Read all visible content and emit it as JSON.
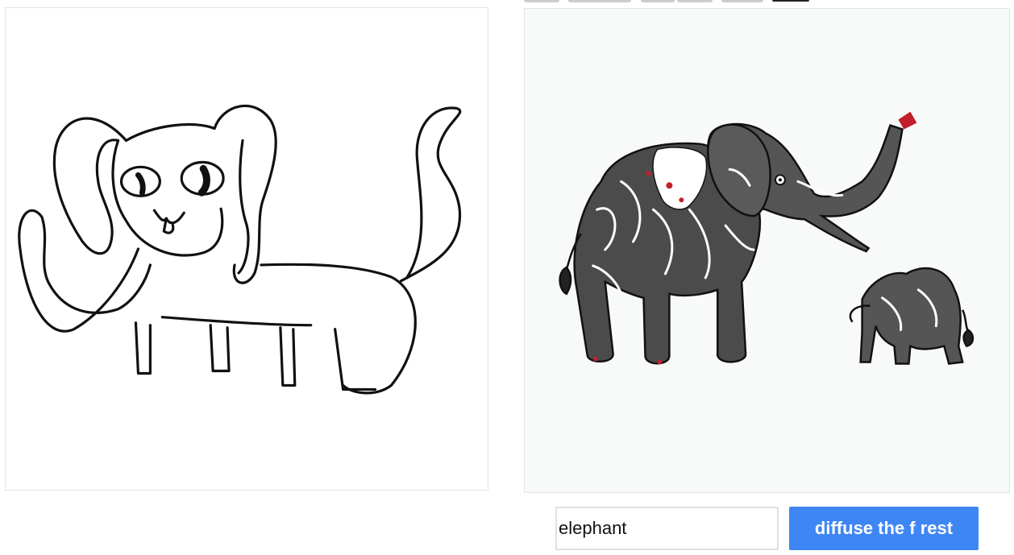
{
  "prompt": {
    "value": "elephant",
    "placeholder": ""
  },
  "generate_button": {
    "label": "diffuse the f rest"
  },
  "colors": {
    "accent": "#3f86f5",
    "ink": "#111111",
    "elephant_body": "#4b4b4b",
    "ornament_red": "#c0202a"
  },
  "icons": {
    "sketch": "cat-like-elephant-doodle",
    "output": "two-ornamental-elephants"
  }
}
